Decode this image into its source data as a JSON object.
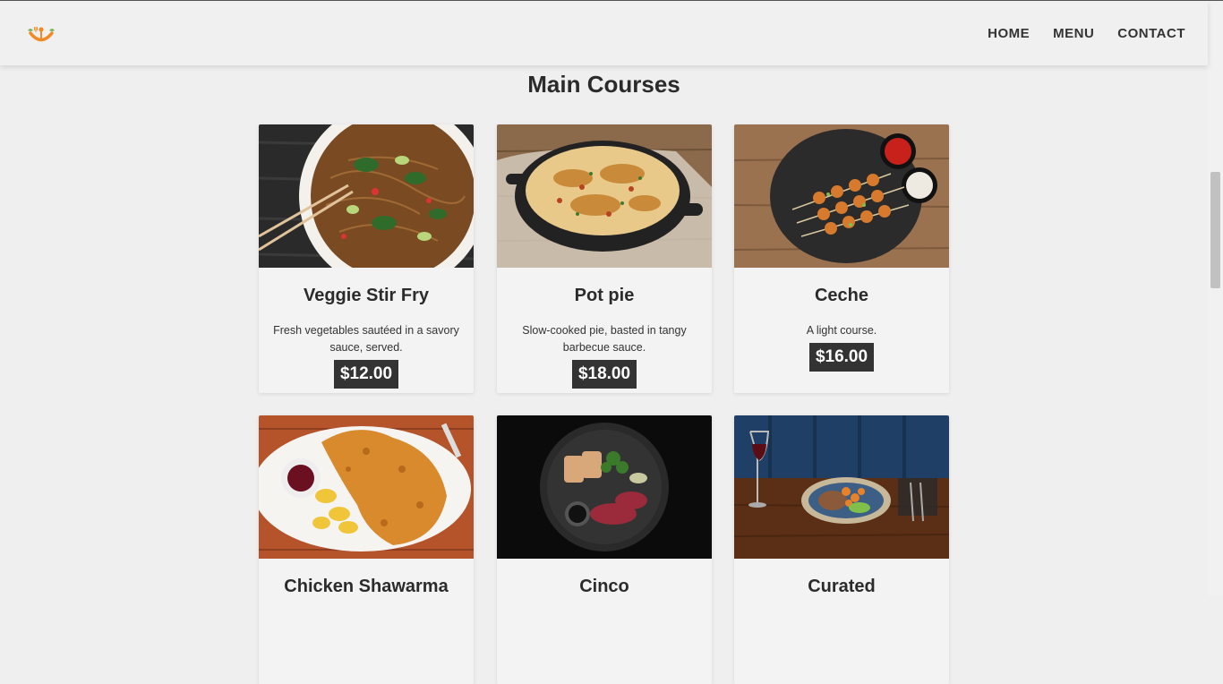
{
  "nav": {
    "home": "HOME",
    "menu": "MENU",
    "contact": "CONTACT"
  },
  "page": {
    "title": "Main Courses"
  },
  "cards": [
    {
      "name": "Veggie Stir Fry",
      "desc": "Fresh vegetables sautéed in a savory sauce, served.",
      "price": "$12.00"
    },
    {
      "name": "Pot pie",
      "desc": "Slow-cooked pie, basted in tangy barbecue sauce.",
      "price": "$18.00"
    },
    {
      "name": "Ceche",
      "desc": "A light course.",
      "price": "$16.00"
    },
    {
      "name": "Chicken Shawarma"
    },
    {
      "name": "Cinco"
    },
    {
      "name": "Curated"
    }
  ],
  "colors": {
    "accent": "#333333",
    "background": "#efefef",
    "logo_orange": "#f08a24",
    "logo_green": "#7bb661"
  }
}
